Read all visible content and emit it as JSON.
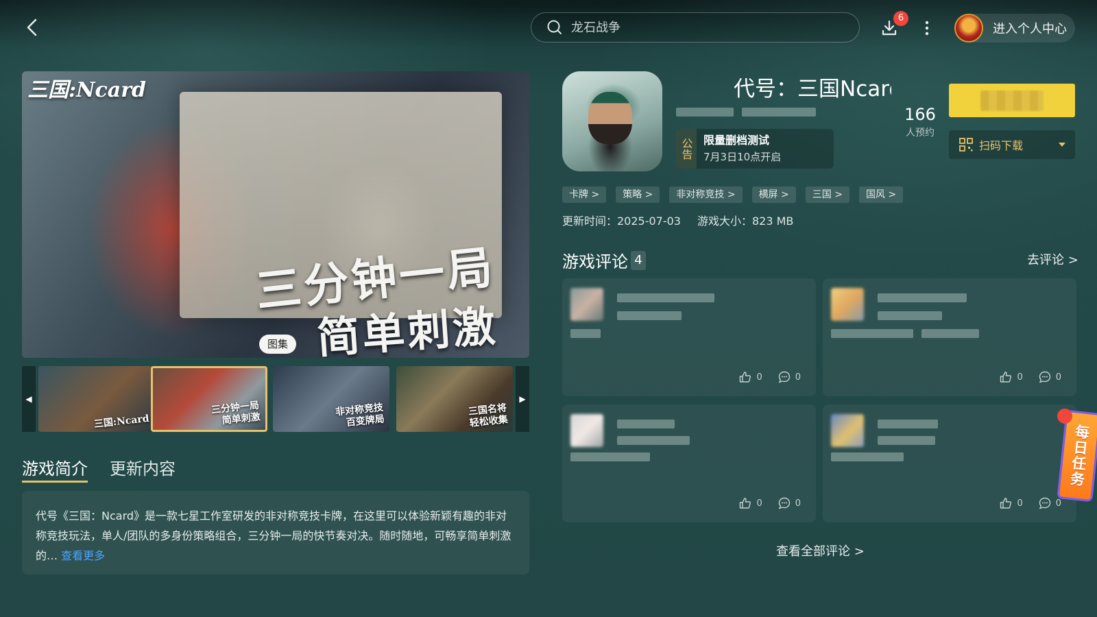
{
  "header": {
    "search_placeholder": "龙石战争",
    "download_badge": "6",
    "user_center_label": "进入个人中心"
  },
  "gallery": {
    "logo_text": "三国:Ncard",
    "slogan_line1": "三分钟一局",
    "slogan_line2": "简单刺激",
    "chip_label": "图集",
    "thumbnails": [
      {
        "caption": "三国:Ncard"
      },
      {
        "caption": "三分钟一局\n简单刺激"
      },
      {
        "caption": "非对称竞技\n百变牌局"
      },
      {
        "caption": "三国名将\n轻松收集"
      }
    ],
    "active_index": 1
  },
  "tabs": [
    {
      "label": "游戏简介"
    },
    {
      "label": "更新内容"
    }
  ],
  "intro": {
    "text": "代号《三国：Ncard》是一款七星工作室研发的非对称竞技卡牌，在这里可以体验新颖有趣的非对称竞技玩法，单人/团队的多身份策略组合，三分钟一局的快节奏对决。随时随地，可畅享简单刺激的…",
    "see_more": "查看更多"
  },
  "game": {
    "title": "代号：三国Ncard",
    "notice_tag": "公告",
    "notice_title": "限量删档测试",
    "notice_sub": "7月3日10点开启",
    "reserve_count": "166",
    "reserve_label": "人预约",
    "scan_download": "扫码下载",
    "tags": [
      "卡牌 >",
      "策略 >",
      "非对称竞技 >",
      "横屏 >",
      "三国 >",
      "国风 >"
    ],
    "update_time": "更新时间：2025-07-03",
    "size": "游戏大小：823 MB"
  },
  "reviews": {
    "title": "游戏评论",
    "count": "4",
    "go_review": "去评论 >",
    "items": [
      {
        "likes": "0",
        "comments": "0"
      },
      {
        "likes": "0",
        "comments": "0"
      },
      {
        "likes": "0",
        "comments": "0"
      },
      {
        "likes": "0",
        "comments": "0"
      }
    ],
    "view_all": "查看全部评论 >"
  },
  "floating": {
    "daily_task": "每日任务"
  },
  "colors": {
    "accent_gold": "#e8c26a",
    "reserve_yellow": "#f2d23c",
    "link_blue": "#4da3ff",
    "badge_red": "#f0463c"
  }
}
